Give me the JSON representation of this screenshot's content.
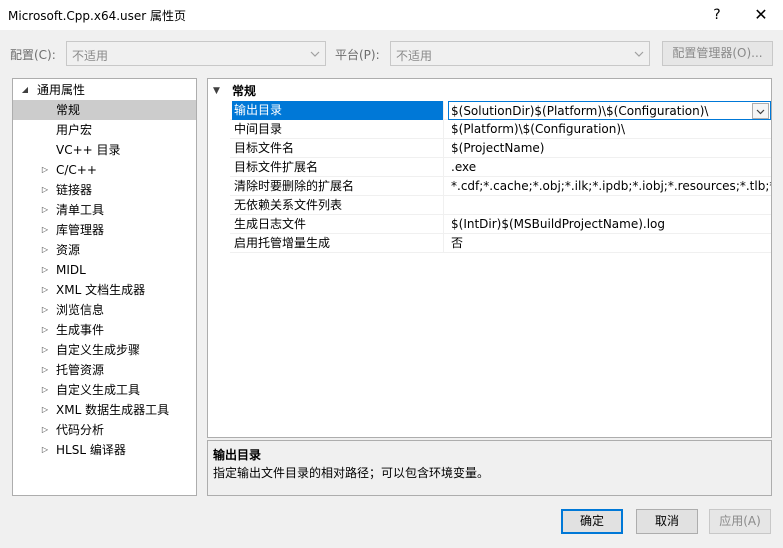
{
  "window": {
    "title": "Microsoft.Cpp.x64.user 属性页",
    "help_glyph": "?",
    "close_glyph": "✕"
  },
  "toolbar": {
    "config_label": "配置(C):",
    "config_value": "不适用",
    "platform_label": "平台(P):",
    "platform_value": "不适用",
    "config_manager_label": "配置管理器(O)..."
  },
  "tree": {
    "root_label": "通用属性",
    "items": [
      {
        "label": "常规",
        "expandable": false
      },
      {
        "label": "用户宏",
        "expandable": false
      },
      {
        "label": "VC++ 目录",
        "expandable": false
      },
      {
        "label": "C/C++",
        "expandable": true
      },
      {
        "label": "链接器",
        "expandable": true
      },
      {
        "label": "清单工具",
        "expandable": true
      },
      {
        "label": "库管理器",
        "expandable": true
      },
      {
        "label": "资源",
        "expandable": true
      },
      {
        "label": "MIDL",
        "expandable": true
      },
      {
        "label": "XML 文档生成器",
        "expandable": true
      },
      {
        "label": "浏览信息",
        "expandable": true
      },
      {
        "label": "生成事件",
        "expandable": true
      },
      {
        "label": "自定义生成步骤",
        "expandable": true
      },
      {
        "label": "托管资源",
        "expandable": true
      },
      {
        "label": "自定义生成工具",
        "expandable": true
      },
      {
        "label": "XML 数据生成器工具",
        "expandable": true
      },
      {
        "label": "代码分析",
        "expandable": true
      },
      {
        "label": "HLSL 编译器",
        "expandable": true
      }
    ]
  },
  "grid": {
    "category": "常规",
    "rows": [
      {
        "name": "输出目录",
        "value": "$(SolutionDir)$(Platform)\\$(Configuration)\\"
      },
      {
        "name": "中间目录",
        "value": "$(Platform)\\$(Configuration)\\"
      },
      {
        "name": "目标文件名",
        "value": "$(ProjectName)"
      },
      {
        "name": "目标文件扩展名",
        "value": ".exe"
      },
      {
        "name": "清除时要删除的扩展名",
        "value": "*.cdf;*.cache;*.obj;*.ilk;*.ipdb;*.iobj;*.resources;*.tlb;*.tli;*.t"
      },
      {
        "name": "无依赖关系文件列表",
        "value": ""
      },
      {
        "name": "生成日志文件",
        "value": "$(IntDir)$(MSBuildProjectName).log"
      },
      {
        "name": "启用托管增量生成",
        "value": "否"
      }
    ]
  },
  "description": {
    "title": "输出目录",
    "text": "指定输出文件目录的相对路径；可以包含环境变量。"
  },
  "buttons": {
    "ok": "确定",
    "cancel": "取消",
    "apply": "应用(A)"
  }
}
